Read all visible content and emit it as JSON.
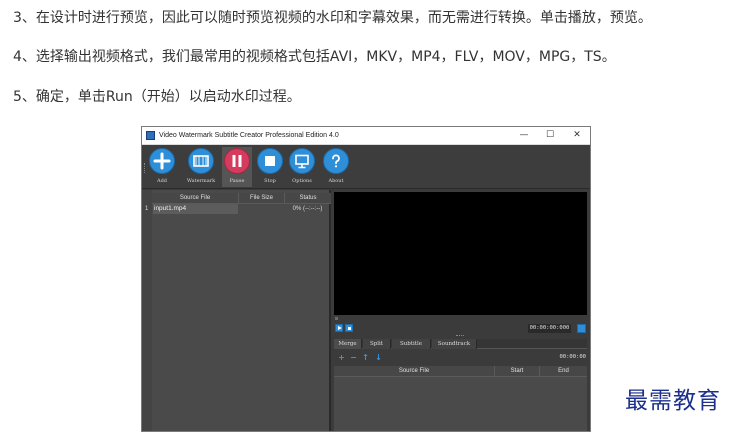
{
  "instructions": {
    "step3": "3、在设计时进行预览，因此可以随时预览视频的水印和字幕效果，而无需进行转换。单击播放，预览。",
    "step4": "4、选择输出视频格式，我们最常用的视频格式包括AVI，MKV，MP4，FLV，MOV，MPG，TS。",
    "step5": "5、确定，单击Run（开始）以启动水印过程。"
  },
  "window": {
    "title": "Video Watermark Subtitle Creator Professional Edition 4.0",
    "minimize_glyph": "—",
    "maximize_glyph": "☐",
    "close_glyph": "✕"
  },
  "toolbar": {
    "add_label": "Add",
    "add_caret": "▾",
    "watermark_label": "Watermark",
    "pause_label": "Pause",
    "stop_label": "Stop",
    "options_label": "Options",
    "about_label": "About"
  },
  "file_list": {
    "columns": [
      "Source File",
      "File Size",
      "Status"
    ],
    "rows": [
      {
        "index": "1",
        "source_file": "input1.mp4",
        "file_size": "",
        "status": "0% (--:--:--)"
      }
    ]
  },
  "player": {
    "time": "00:00:00:000"
  },
  "tabs": [
    "Merge",
    "Split",
    "Subtitle",
    "Soundtrack"
  ],
  "merge_panel": {
    "time": "00:00:00",
    "columns": [
      "Source File",
      "Start",
      "End"
    ]
  },
  "colors": {
    "accent_blue": "#2e8fd8",
    "pause_red": "#d43b5c",
    "window_bg": "#3b3b3b",
    "logo_text": "#1c2f8c"
  },
  "site_logo": "最需教育"
}
